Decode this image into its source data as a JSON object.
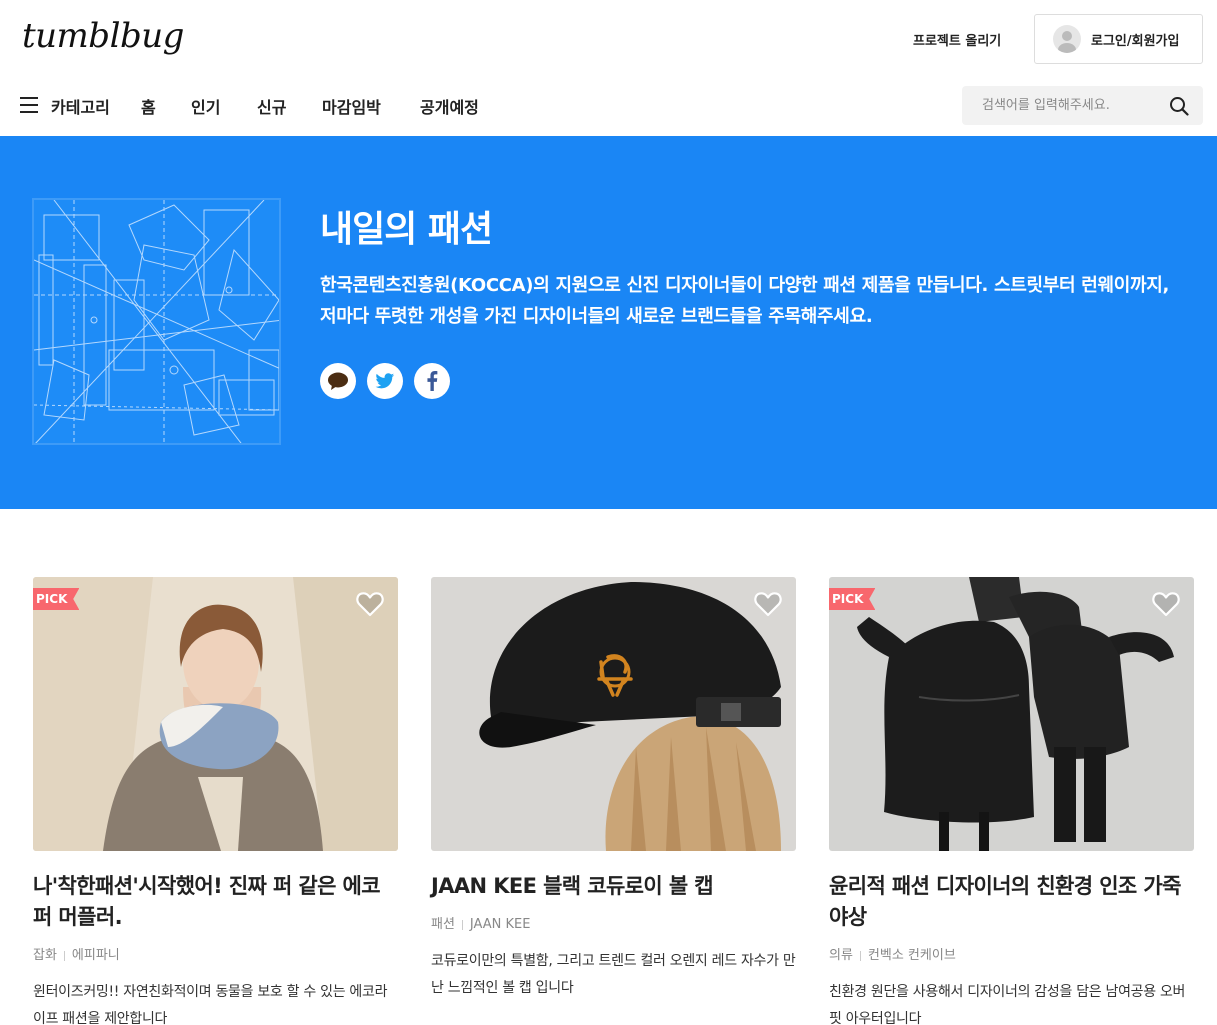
{
  "header": {
    "logo": "tumblbug",
    "upload_label": "프로젝트 올리기",
    "login_label": "로그인/회원가입"
  },
  "nav": {
    "category_label": "카테고리",
    "items": [
      "홈",
      "인기",
      "신규",
      "마감임박",
      "공개예정"
    ],
    "search_placeholder": "검색어를 입력해주세요."
  },
  "hero": {
    "title": "내일의 패션",
    "description": "한국콘텐츠진흥원(KOCCA)의 지원으로 신진 디자이너들이 다양한 패션 제품을 만듭니다. 스트릿부터 런웨이까지, 저마다 뚜렷한 개성을 가진 디자이너들의 새로운 브랜드들을 주목해주세요.",
    "background_color": "#1a86f5",
    "share_icons": [
      "kakaotalk-icon",
      "twitter-icon",
      "facebook-icon"
    ]
  },
  "cards": [
    {
      "badge": "PICK",
      "title": "나'착한패션'시작했어! 진짜 퍼 같은 에코퍼 머플러.",
      "category": "잡화",
      "creator": "에피파니",
      "description": "윈터이즈커밍!! 자연친화적이며 동물을 보호 할 수 있는 에코라이프 패션을 제안합니다"
    },
    {
      "badge": "",
      "title": "JAAN KEE 블랙 코듀로이 볼 캡",
      "category": "패션",
      "creator": "JAAN KEE",
      "description": "코듀로이만의 특별함, 그리고 트렌드 컬러 오렌지 레드 자수가 만난 느낌적인 볼 캡 입니다"
    },
    {
      "badge": "PICK",
      "title": "윤리적 패션 디자이너의 친환경 인조 가죽 야상",
      "category": "의류",
      "creator": "컨벡소 컨케이브",
      "description": "친환경 원단을 사용해서 디자이너의 감성을 담은 남여공용 오버핏 아우터입니다"
    }
  ],
  "colors": {
    "accent": "#1a86f5",
    "pick_badge": "#f8676d"
  }
}
